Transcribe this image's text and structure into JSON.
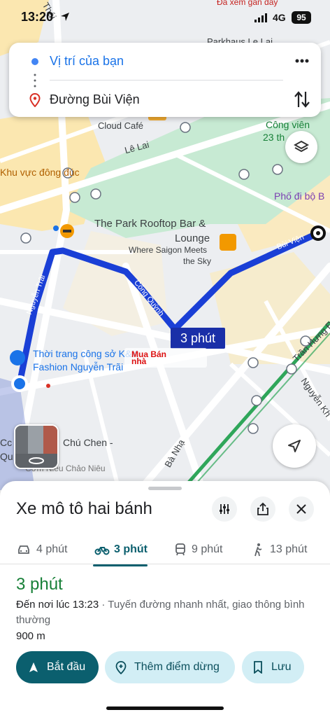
{
  "status_bar": {
    "time": "13:20",
    "network": "4G",
    "battery": "95"
  },
  "directions": {
    "origin": "Vị trí của bạn",
    "destination": "Đường Bùi Viện"
  },
  "map": {
    "labels": {
      "cloud_cafe": "Cloud Café",
      "le_lai": "Lê Lai",
      "khu_vuc": "Khu vực đông đúc",
      "park_rooftop": "The Park Rooftop Bar &",
      "lounge": "Lounge",
      "where_saigon": "Where Saigon Meets",
      "the_sky": "the Sky",
      "pho_di_bo": "Phố đi bộ B",
      "bui_vien": "Bùi Viện",
      "cong_quynh": "Cống Quỳnh",
      "nguyen_trai": "Nguyễn Trãi",
      "thoi_trang_1": "Thời trang công sở K&K",
      "thoi_trang_2": "Fashion Nguyễn Trãi",
      "tran_hung": "Trần Hưng Đ",
      "nguyen_khac": "Nguyễn Kh",
      "ba_nha": "Bà Nhạ",
      "chu_chen": "Chú Chen -",
      "com_nieu": "Cơm Niêu Chảo Niêu",
      "cong_vien": "Công viên",
      "cong_vien_2": "23 th",
      "parkhaus": "Parkhaus Le Lai",
      "da_xem": "Đã xem gần đây",
      "cc": "Cc",
      "q": "Qu",
      "thai": "Thái"
    },
    "route_time": "3 phút",
    "watermark": "Mua Bán nhà"
  },
  "sheet": {
    "title": "Xe mô tô hai bánh",
    "modes": [
      {
        "label": "4 phút",
        "icon": "car-icon"
      },
      {
        "label": "3 phút",
        "icon": "motorbike-icon"
      },
      {
        "label": "9 phút",
        "icon": "transit-icon"
      },
      {
        "label": "13 phút",
        "icon": "walk-icon"
      }
    ],
    "duration": "3 phút",
    "arrive_time": "Đến nơi lúc 13:23",
    "arrive_note": " · Tuyến đường nhanh nhất, giao thông bình thường",
    "distance": "900 m",
    "actions": {
      "start": "Bắt đầu",
      "add_stop": "Thêm điểm dừng",
      "save": "Lưu"
    }
  },
  "colors": {
    "route": "#1a3fd6",
    "accent": "#0b5f6e",
    "green": "#188038",
    "park": "#c7ead3"
  }
}
